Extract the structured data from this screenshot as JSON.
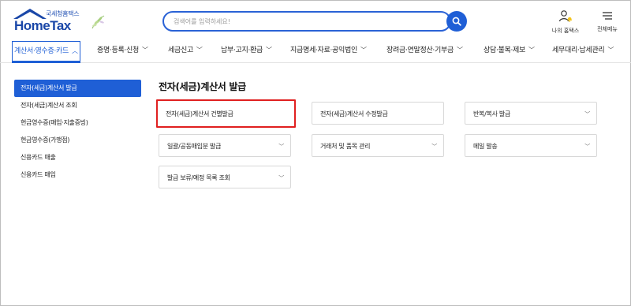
{
  "header": {
    "logo_top": "국세청홈택스",
    "logo_main": "HomeTax",
    "search_placeholder": "검색어를 입력하세요!",
    "my_hometax": "나의 홈택스",
    "all_menu": "전체메뉴"
  },
  "gnb": {
    "items": [
      {
        "label": "계산서·영수증·카드"
      },
      {
        "label": "증명·등록·신청"
      },
      {
        "label": "세금신고"
      },
      {
        "label": "납부·고지·환급"
      },
      {
        "label": "지급명세·자료·공익법인"
      },
      {
        "label": "장려금·연말정산·기부금"
      },
      {
        "label": "상담·불복·제보"
      },
      {
        "label": "세무대리·납세관리"
      }
    ]
  },
  "sidebar": {
    "items": [
      {
        "label": "전자(세금)계산서 발급"
      },
      {
        "label": "전자(세금)계산서 조회"
      },
      {
        "label": "현금영수증(매입·지출증빙)"
      },
      {
        "label": "현금영수증(가맹점)"
      },
      {
        "label": "신용카드 매출"
      },
      {
        "label": "신용카드 매입"
      }
    ]
  },
  "main": {
    "title": "전자(세금)계산서 발급",
    "cards": [
      {
        "label": "전자(세금)계산서 건별발급"
      },
      {
        "label": "전자(세금)계산서 수정발급"
      },
      {
        "label": "반복/복사 발급"
      },
      {
        "label": "일괄/공동매입분 발급"
      },
      {
        "label": "거래처 및 품목 관리"
      },
      {
        "label": "메일 발송"
      },
      {
        "label": "발급 보류/예정 목록 조회"
      }
    ]
  },
  "colors": {
    "brand_blue": "#1f5fd6",
    "highlight_red": "#e02020"
  },
  "icons": [
    "house-logo-icon",
    "leaf-icon",
    "search-icon",
    "user-bell-icon",
    "hamburger-menu-icon",
    "chevron-down-icon",
    "chevron-up-icon"
  ]
}
